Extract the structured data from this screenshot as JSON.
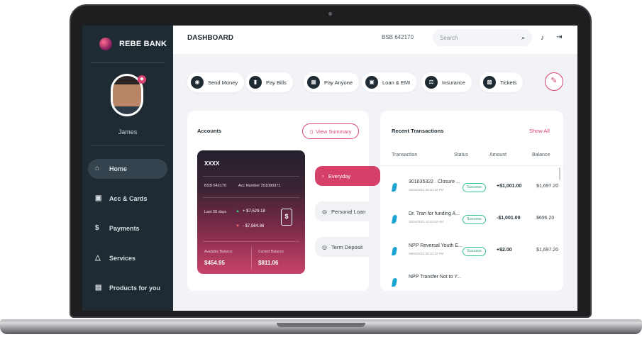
{
  "brand": {
    "name": "REBE BANK"
  },
  "user": {
    "name": "James"
  },
  "sidebar": {
    "items": [
      {
        "label": "Home",
        "icon": "home-icon",
        "glyph": "⌂"
      },
      {
        "label": "Acc & Cards",
        "icon": "card-icon",
        "glyph": "▣"
      },
      {
        "label": "Payments",
        "icon": "dollar-icon",
        "glyph": "$"
      },
      {
        "label": "Services",
        "icon": "services-icon",
        "glyph": "△"
      },
      {
        "label": "Products for you",
        "icon": "products-icon",
        "glyph": "▤"
      }
    ]
  },
  "header": {
    "title": "DASHBOARD",
    "bsb": "BSB 642170",
    "search_placeholder": "Search",
    "search_glyph": "⌕",
    "bell_glyph": "♪",
    "logout_glyph": "⇥"
  },
  "quick_actions": [
    {
      "label": "Send Money",
      "glyph": "◉"
    },
    {
      "label": "Pay Bills",
      "glyph": "▮"
    },
    {
      "label": "Pay Anyone",
      "glyph": "▦"
    },
    {
      "label": "Loan & EMI",
      "glyph": "▣"
    },
    {
      "label": "Insurance",
      "glyph": "⚖"
    },
    {
      "label": "Tickets",
      "glyph": "▩"
    }
  ],
  "edit_glyph": "✎",
  "accounts": {
    "title": "Accounts",
    "view_summary": "View Summary",
    "card": {
      "number": "XXXX",
      "bsb": "BSB 642170",
      "acc_number": "Acc Number 251080371",
      "period": "Last 30 days",
      "money_in": "+ $7,529.18",
      "money_out": "- $7,564.86",
      "dollar_glyph": "$",
      "available_label": "Available Balance",
      "available_value": "$454.95",
      "current_label": "Current Balance",
      "current_value": "$811.06"
    },
    "tabs": [
      {
        "label": "Everyday"
      },
      {
        "label": "Personal Loan"
      },
      {
        "label": "Term Deposit"
      }
    ]
  },
  "recent": {
    "title": "Recent Transactions",
    "show_all": "Show All",
    "columns": [
      "Transaction",
      "Status",
      "Amount",
      "Balance"
    ],
    "rows": [
      {
        "name": "301035322 . Closure ...",
        "date": "30/04/2021 08:30:10 PM",
        "status": "Success",
        "amount": "+$1,001.00",
        "balance": "$1,697.20"
      },
      {
        "name": "Dr. Tran for funding A...",
        "date": "30/04/2021 10:40:52 AM",
        "status": "Success",
        "amount": "-$1,001.00",
        "balance": "$696.20"
      },
      {
        "name": "NPP Reversal Youth E...",
        "date": "09/04/2021 08:30:10 PM",
        "status": "Success",
        "amount": "+$2.00",
        "balance": "$1,697.20"
      },
      {
        "name": "NPP Transfer Not to Y...",
        "date": "",
        "status": "",
        "amount": "",
        "balance": ""
      }
    ]
  },
  "colors": {
    "accent": "#d9436f",
    "sidebar": "#1f2b33",
    "success": "#39c28c"
  }
}
